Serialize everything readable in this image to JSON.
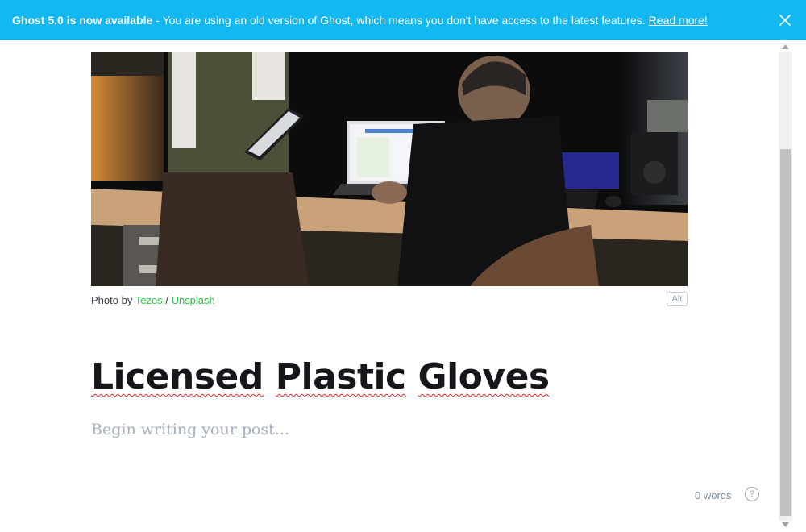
{
  "banner": {
    "headline": "Ghost 5.0 is now available",
    "message": "- You are using an old version of Ghost, which means you don't have access to the latest features.",
    "link_label": "Read more!",
    "close_icon": "close-icon",
    "background_color": "#14b8f0"
  },
  "feature_image": {
    "caption_prefix": "Photo by",
    "author_link": "Tezos",
    "separator": "/",
    "source_link": "Unsplash",
    "alt_button_label": "Alt"
  },
  "post": {
    "title_words": [
      "Licensed",
      "Plastic",
      "Gloves"
    ],
    "body_placeholder": "Begin writing your post..."
  },
  "footer": {
    "word_count": "0 words",
    "help_icon_label": "?"
  }
}
